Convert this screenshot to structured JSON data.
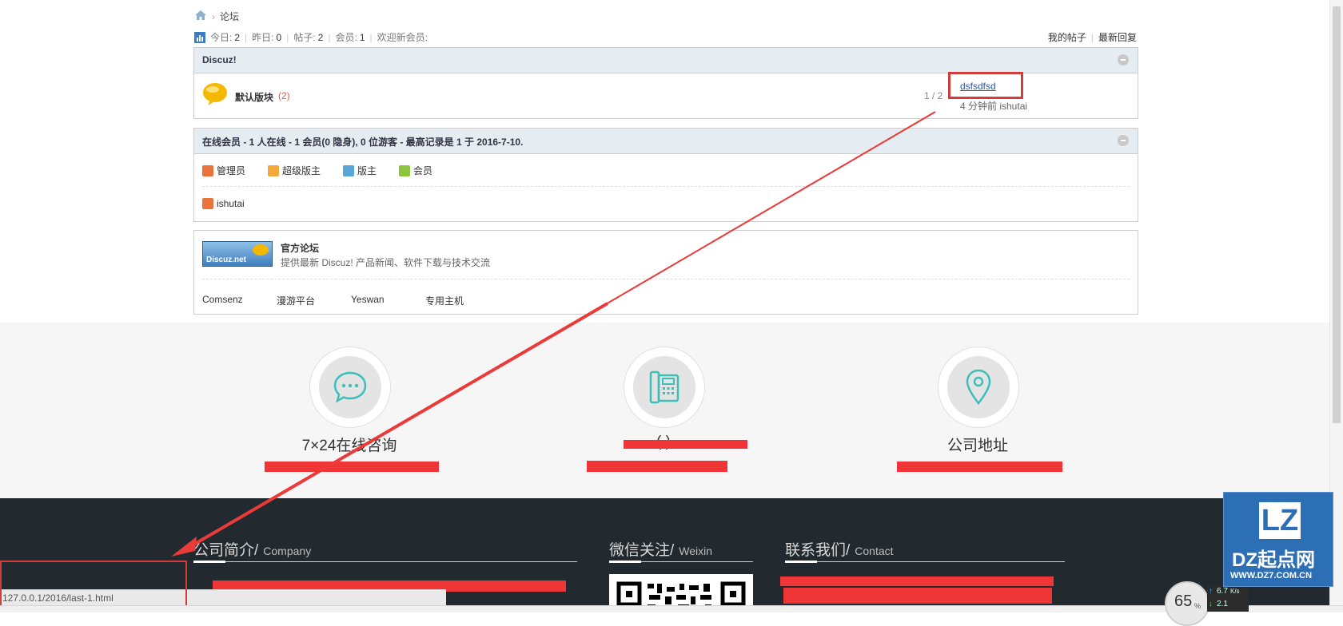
{
  "breadcrumb": {
    "home_icon": "home-icon",
    "current": "论坛"
  },
  "stats": {
    "today_label": "今日:",
    "today": "2",
    "yesterday_label": "昨日:",
    "yesterday": "0",
    "posts_label": "帖子:",
    "posts": "2",
    "members_label": "会员:",
    "members": "1",
    "welcome": "欢迎新会员:"
  },
  "toplinks": {
    "my_posts": "我的帖子",
    "latest_replies": "最新回复"
  },
  "forum_box": {
    "title": "Discuz!",
    "forum_name": "默认版块",
    "forum_count": "(2)",
    "count_ratio": "1 / 2",
    "last_post_title": "dsfsdfsd",
    "last_post_meta": "4 分钟前 ishutai"
  },
  "online_box": {
    "title": "在线会员 - 1 人在线 - 1 会员(0 隐身), 0 位游客 - 最高记录是 1 于 2016-7-10.",
    "legend": [
      "管理员",
      "超级版主",
      "版主",
      "会员"
    ],
    "user": "ishutai"
  },
  "links_box": {
    "logo_text": "Discuz.net",
    "title": "官方论坛",
    "desc": "提供最新 Discuz! 产品新闻、软件下载与技术交流",
    "links": [
      "Comsenz",
      "漫游平台",
      "Yeswan",
      "专用主机"
    ]
  },
  "contact": {
    "consult": "7×24在线咨询",
    "phone": "(    )  ",
    "address": "公司地址"
  },
  "footer": {
    "company_cn": "公司简介/",
    "company_en": "Company",
    "weixin_cn": "微信关注/",
    "weixin_en": "Weixin",
    "contact_cn": "联系我们/",
    "contact_en": "Contact"
  },
  "statusbar": {
    "url": "127.0.0.1/2016/last-1.html"
  },
  "widgets": {
    "speed_percent": "65",
    "speed_unit": "%",
    "net_up": "6.7",
    "net_unit": "K/s",
    "net_down": "2.1",
    "watermark_logo": "LZ",
    "watermark_brand": "DZ起点网",
    "watermark_url": "WWW.DZ7.COM.CN"
  },
  "colors": {
    "accent": "#ef3535",
    "footer_bg": "#232a2f",
    "header_bg": "#e5edf2",
    "teal_icon": "#3cbfb8",
    "watermark_bg": "#2d6fb5"
  }
}
